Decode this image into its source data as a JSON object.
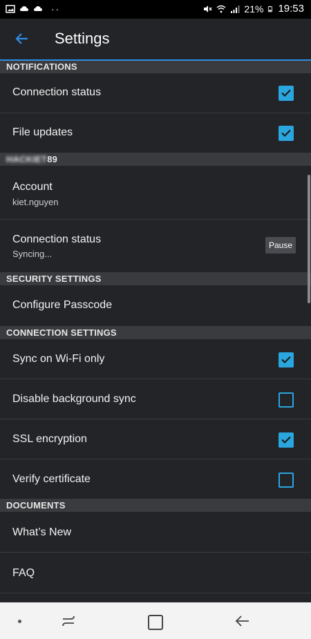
{
  "status_bar": {
    "battery": "21%",
    "time": "19:53",
    "icons": [
      "gallery-icon",
      "cloud-icon",
      "cloud-icon",
      "more-dots-icon",
      "mute-icon",
      "wifi-icon",
      "signal-icon",
      "battery-icon"
    ]
  },
  "header": {
    "title": "Settings"
  },
  "sections": {
    "notifications": "NOTIFICATIONS",
    "account_prefix_blurred": "HACKIET",
    "account_suffix": "89",
    "security": "SECURITY SETTINGS",
    "connection": "CONNECTION SETTINGS",
    "documents": "DOCUMENTS"
  },
  "notifications": {
    "connection_status": {
      "label": "Connection status",
      "checked": true
    },
    "file_updates": {
      "label": "File updates",
      "checked": true
    }
  },
  "account": {
    "account_label": "Account",
    "account_value": "kiet.nguyen",
    "conn_label": "Connection status",
    "conn_value": "Syncing...",
    "pause_label": "Pause"
  },
  "security": {
    "passcode_label": "Configure Passcode"
  },
  "connection": {
    "wifi_only": {
      "label": "Sync on Wi-Fi only",
      "checked": true
    },
    "disable_bg": {
      "label": "Disable background sync",
      "checked": false
    },
    "ssl": {
      "label": "SSL encryption",
      "checked": true
    },
    "verify_cert": {
      "label": "Verify certificate",
      "checked": false
    }
  },
  "documents": {
    "whats_new": "What’s New",
    "faq": "FAQ"
  },
  "colors": {
    "accent": "#2aa6df",
    "header_underline": "#2f8ee6",
    "background": "#232428",
    "section_bg": "#3a3b3f"
  }
}
